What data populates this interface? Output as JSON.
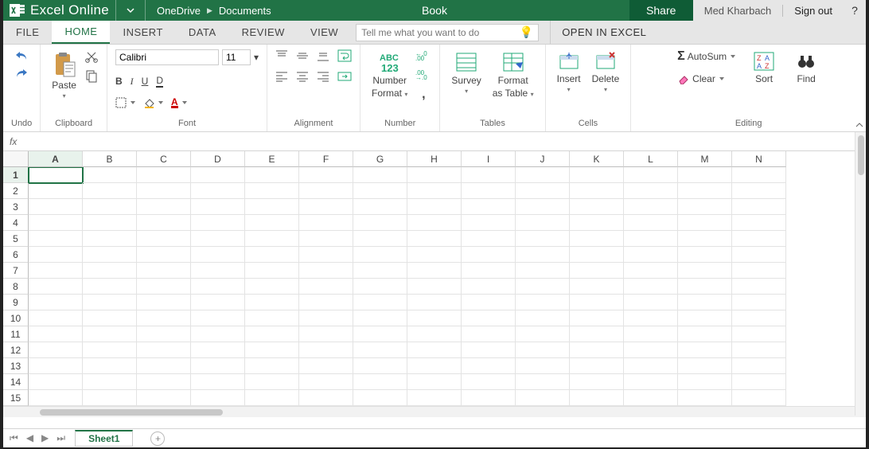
{
  "titlebar": {
    "app_name": "Excel Online",
    "breadcrumb_root": "OneDrive",
    "breadcrumb_folder": "Documents",
    "doc_title": "Book",
    "share_label": "Share",
    "user_name": "Med Kharbach",
    "sign_out": "Sign out",
    "help": "?"
  },
  "tabs": {
    "items": [
      "FILE",
      "HOME",
      "INSERT",
      "DATA",
      "REVIEW",
      "VIEW"
    ],
    "active_index": 1,
    "tellme_placeholder": "Tell me what you want to do",
    "open_in_excel": "OPEN IN EXCEL"
  },
  "ribbon": {
    "undo": {
      "cap": "Undo"
    },
    "clipboard": {
      "paste_label": "Paste",
      "cap": "Clipboard"
    },
    "font": {
      "name_value": "Calibri",
      "size_value": "11",
      "cap": "Font"
    },
    "alignment": {
      "cap": "Alignment"
    },
    "number": {
      "label1": "Number",
      "label2": "Format",
      "cap": "Number"
    },
    "tables": {
      "survey": "Survey",
      "format_as": "Format",
      "format_as2": "as Table",
      "cap": "Tables"
    },
    "cells": {
      "insert": "Insert",
      "delete": "Delete",
      "cap": "Cells"
    },
    "editing": {
      "autosum": "AutoSum",
      "clear": "Clear",
      "sort": "Sort",
      "find": "Find",
      "cap": "Editing"
    }
  },
  "fx": {
    "label": "fx",
    "value": ""
  },
  "grid": {
    "columns": [
      "A",
      "B",
      "C",
      "D",
      "E",
      "F",
      "G",
      "H",
      "I",
      "J",
      "K",
      "L",
      "M",
      "N"
    ],
    "rows": [
      1,
      2,
      3,
      4,
      5,
      6,
      7,
      8,
      9,
      10,
      11,
      12,
      13,
      14,
      15
    ],
    "selected": {
      "col": "A",
      "row": 1
    }
  },
  "sheets": {
    "active": "Sheet1"
  },
  "colors": {
    "brand": "#217346",
    "brand_dark": "#0f5c36"
  }
}
